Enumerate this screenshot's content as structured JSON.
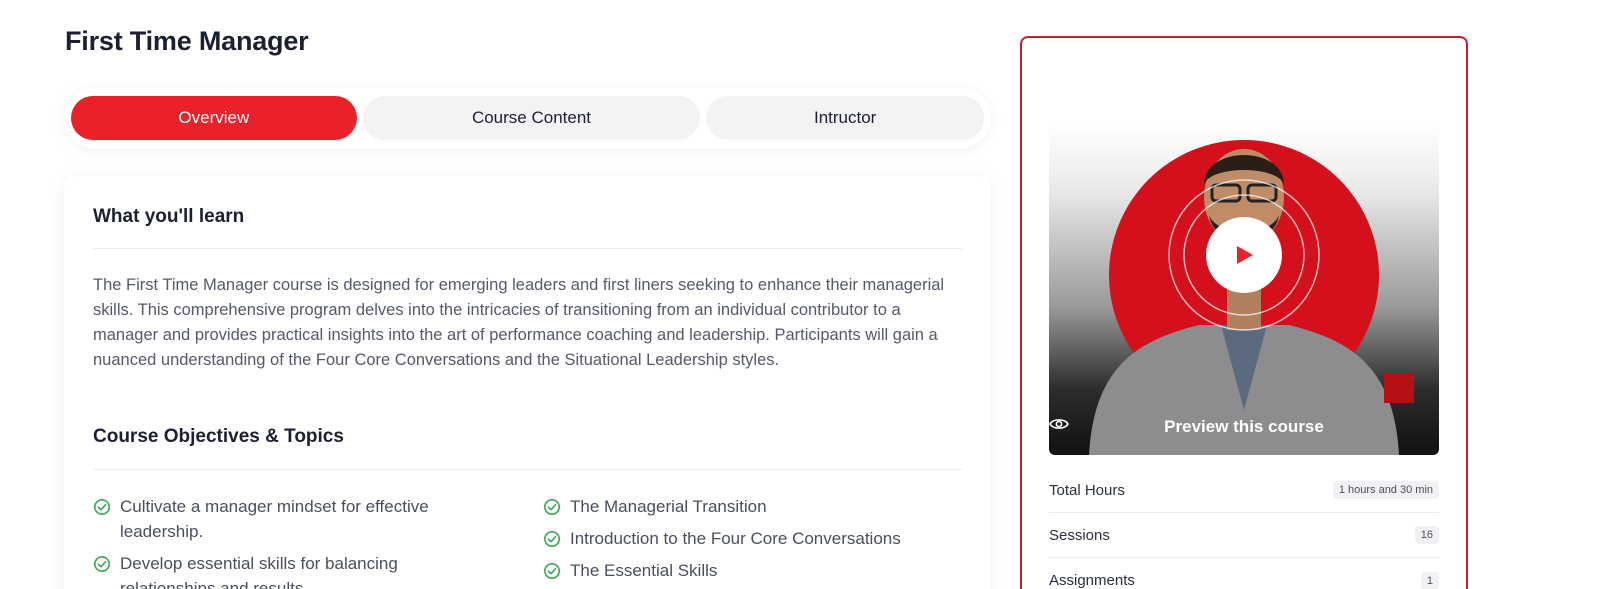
{
  "page": {
    "title": "First Time Manager"
  },
  "tabs": [
    {
      "label": "Overview",
      "active": true
    },
    {
      "label": "Course Content",
      "active": false
    },
    {
      "label": "Intructor",
      "active": false
    }
  ],
  "overview": {
    "learn_heading": "What you'll learn",
    "description": "The First Time Manager course is designed for emerging leaders and first liners seeking to enhance their managerial skills. This comprehensive program delves into the intricacies of transitioning from an individual contributor to a manager and provides practical insights into the art of performance coaching and leadership. Participants will gain a nuanced understanding of the Four Core Conversations and the Situational Leadership styles.",
    "objectives_heading": "Course Objectives & Topics",
    "objectives": [
      "Cultivate a manager mindset for effective leadership.",
      "Develop essential skills for balancing relationships and results.",
      "The Managerial Transition",
      "Introduction to the Four Core Conversations",
      "The Essential Skills"
    ]
  },
  "sidebar": {
    "preview_label": "Preview this course",
    "stats": [
      {
        "label": "Total Hours",
        "value": "1 hours and 30 min"
      },
      {
        "label": "Sessions",
        "value": "16"
      },
      {
        "label": "Assignments",
        "value": "1"
      }
    ]
  },
  "colors": {
    "accent": "#e8212b",
    "card_border": "#c8202a",
    "check": "#3aa856",
    "heading": "#1b2033"
  },
  "icons": {
    "check": "check-circle-icon",
    "play": "play-icon",
    "eye": "eye-icon"
  }
}
